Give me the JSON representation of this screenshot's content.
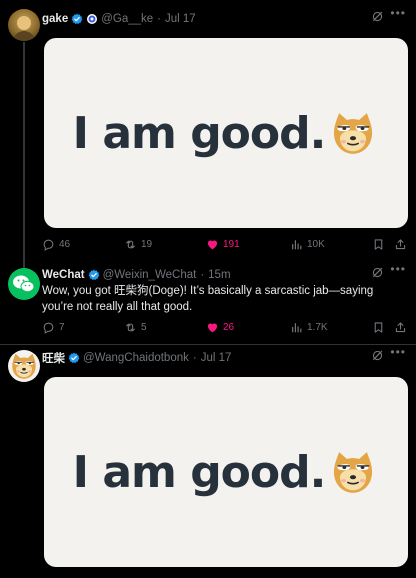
{
  "posts": [
    {
      "display_name": "gake",
      "handle": "@Ga__ke",
      "sep": "·",
      "time": "Jul 17",
      "media_text": "I am good.",
      "replies": "46",
      "reposts": "19",
      "likes": "191",
      "views": "10K"
    },
    {
      "display_name": "WeChat",
      "handle": "@Weixin_WeChat",
      "sep": "·",
      "time": "15m",
      "text": "Wow, you got 旺柴狗(Doge)! It’s basically a sarcastic jab—saying you’re not really all that good.",
      "replies": "7",
      "reposts": "5",
      "likes": "26",
      "views": "1.7K"
    },
    {
      "display_name": "旺柴",
      "handle": "@WangChaidotbonk",
      "sep": "·",
      "time": "Jul 17",
      "media_text": "I am good."
    }
  ],
  "colors": {
    "background": "#000000",
    "verified": "#1d9bf0",
    "like": "#f91880",
    "muted": "#71767b",
    "media_bg": "#f4f2ef",
    "media_text": "#26313b"
  },
  "icons": [
    "verified-badge-icon",
    "reply-icon",
    "repost-icon",
    "heart-icon",
    "views-icon",
    "bookmark-icon",
    "share-icon",
    "grok-icon",
    "more-icon",
    "doge-icon"
  ]
}
